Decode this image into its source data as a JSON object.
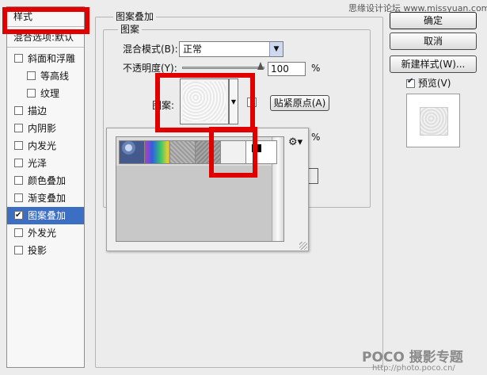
{
  "watermark_top": "思缘设计论坛 www.missyuan.com",
  "watermark_bottom": {
    "brand": "POCO 摄影专题",
    "url": "http://photo.poco.cn/"
  },
  "left_panel": {
    "header": "样式",
    "blend_options": "混合选项:默认",
    "items": [
      {
        "label": "斜面和浮雕",
        "checked": false
      },
      {
        "label": "等高线",
        "checked": false
      },
      {
        "label": "纹理",
        "checked": false
      },
      {
        "label": "描边",
        "checked": false
      },
      {
        "label": "内阴影",
        "checked": false
      },
      {
        "label": "内发光",
        "checked": false
      },
      {
        "label": "光泽",
        "checked": false
      },
      {
        "label": "颜色叠加",
        "checked": false
      },
      {
        "label": "渐变叠加",
        "checked": false
      },
      {
        "label": "图案叠加",
        "checked": true,
        "selected": true
      },
      {
        "label": "外发光",
        "checked": false
      },
      {
        "label": "投影",
        "checked": false
      }
    ]
  },
  "main": {
    "group_title": "图案叠加",
    "sub_group_title": "图案",
    "blend_mode_label": "混合模式(B):",
    "blend_mode_value": "正常",
    "opacity_label": "不透明度(Y):",
    "opacity_value": "100",
    "percent": "%",
    "pattern_label": "图案:",
    "snap_origin_button": "贴紧原点(A)",
    "scale_percent": "%"
  },
  "right_panel": {
    "ok_button": "确定",
    "cancel_button": "取消",
    "new_style_button": "新建样式(W)...",
    "preview_label": "预览(V)",
    "preview_checked": true
  },
  "pattern_picker": {
    "menu_icon": "gear-icon",
    "swatches": [
      "blue-bubbles",
      "rainbow",
      "gray-noise",
      "dark-gray-noise",
      "white-texture",
      "black-square"
    ]
  },
  "colors": {
    "highlight": "#e10000",
    "selection": "#3c6fc4"
  }
}
